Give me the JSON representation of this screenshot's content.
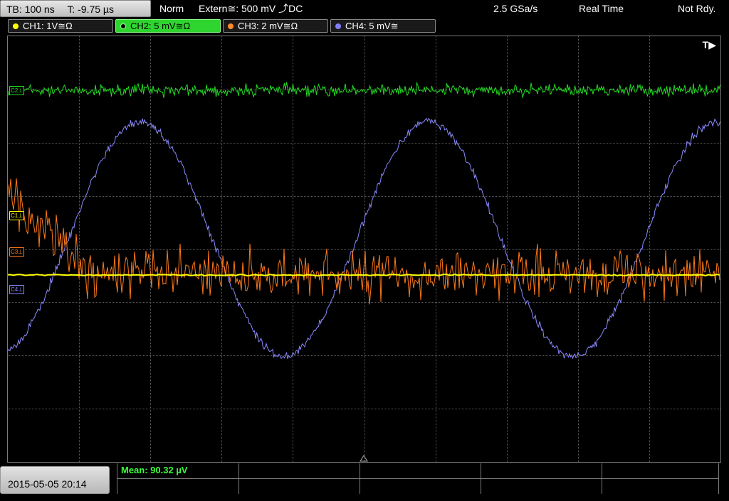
{
  "header": {
    "timebase": "TB: 100 ns",
    "trigger_time": "T: -9.75 µs",
    "mode": "Norm",
    "trigger_source": "Extern≅: 500 mV ⤴DC",
    "sample_rate": "2.5 GSa/s",
    "acquisition": "Real Time",
    "status": "Not Rdy."
  },
  "channels": [
    {
      "label": "CH1: 1V≅Ω",
      "color": "#ffff00",
      "active": false
    },
    {
      "label": "CH2: 5 mV≅Ω",
      "color": "#2fd52f",
      "active": true
    },
    {
      "label": "CH3: 2 mV≅Ω",
      "color": "#ff8c28",
      "active": false
    },
    {
      "label": "CH4: 5 mV≅",
      "color": "#8080ff",
      "active": false
    }
  ],
  "markers": {
    "ch1": "C1⊥",
    "ch2": "C2⊥",
    "ch3": "C3⊥",
    "ch4": "C4⊥"
  },
  "trigger_position": "T▶",
  "footer": {
    "datetime": "2015-05-05 20:14",
    "measurement": "Mean: 90.32 µV"
  },
  "colors": {
    "ch1": "#ffff00",
    "ch2": "#22dd22",
    "ch3": "#ff7a1a",
    "ch4": "#8a8aff",
    "grid": "#5a5a5a"
  }
}
